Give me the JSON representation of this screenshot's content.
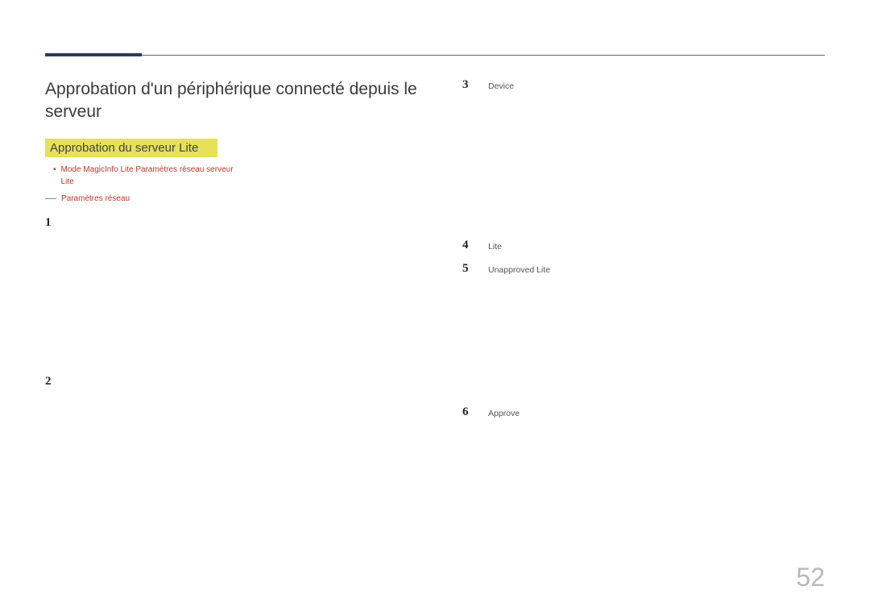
{
  "title": "Approbation d'un périphérique connecté depuis le serveur",
  "subheading": "Approbation du serveur Lite",
  "bullet": {
    "prefix": "",
    "p1": "Mode MagicInfo",
    "p2": "Lite",
    "p3": "Paramètres réseau serveur",
    "p4": "Lite"
  },
  "note": {
    "text": "Paramètres réseau"
  },
  "left_steps": {
    "s1": {
      "num": "1",
      "body": ""
    },
    "s2": {
      "num": "2",
      "body": ""
    }
  },
  "right_steps": {
    "s3": {
      "num": "3",
      "t1": "Device"
    },
    "s4": {
      "num": "4",
      "t1": "Lite"
    },
    "s5": {
      "num": "5",
      "t1": "Unapproved",
      "t2": "Lite"
    },
    "s6": {
      "num": "6",
      "t1": "Approve",
      "t2": ""
    }
  },
  "page_number": "52"
}
